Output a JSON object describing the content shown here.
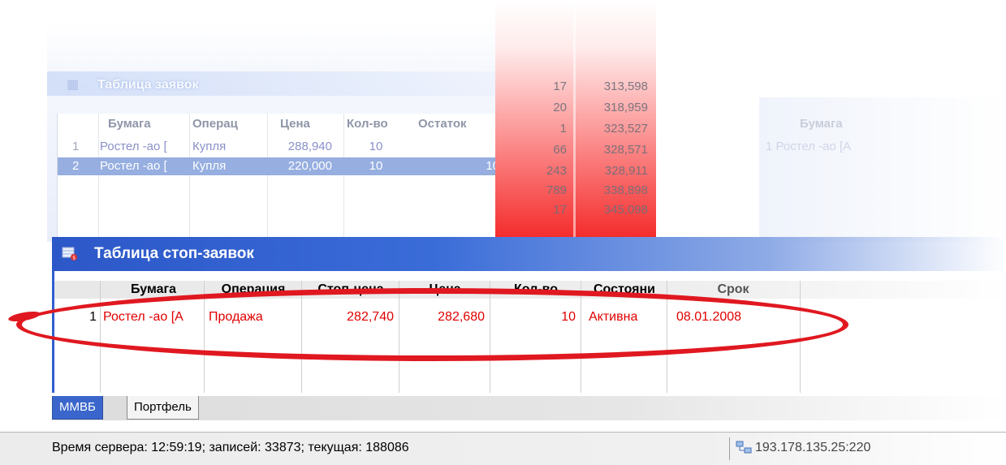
{
  "orders_window": {
    "title": "Таблица заявок",
    "columns": [
      "Бумага",
      "Операц",
      "Цена",
      "Кол-во",
      "Остаток"
    ],
    "rows": [
      {
        "num": "1",
        "paper": "Ростел -ао [",
        "operation": "Купля",
        "price": "288,940",
        "qty": "10",
        "rest": ""
      },
      {
        "num": "2",
        "paper": "Ростел -ао [",
        "operation": "Купля",
        "price": "220,000",
        "qty": "10",
        "rest": "10"
      }
    ]
  },
  "price_ladder": {
    "rows": [
      {
        "qty": "17",
        "price": "313,598"
      },
      {
        "qty": "20",
        "price": "318,959"
      },
      {
        "qty": "1",
        "price": "323,527"
      },
      {
        "qty": "66",
        "price": "328,571"
      },
      {
        "qty": "243",
        "price": "328,911"
      },
      {
        "qty": "789",
        "price": "338,898"
      },
      {
        "qty": "17",
        "price": "345,098"
      }
    ]
  },
  "right_panel": {
    "header": "Бумага",
    "row": "1  Ростел -ао [А"
  },
  "stop_window": {
    "title": "Таблица стоп-заявок",
    "columns": [
      "Бумага",
      "Операция",
      "Стоп-цена",
      "Цена",
      "Кол-во",
      "Состояни",
      "Срок"
    ],
    "row": {
      "num": "1",
      "paper": "Ростел -ао [А",
      "operation": "Продажа",
      "stop_price": "282,740",
      "price": "282,680",
      "qty": "10",
      "state": "Активна",
      "term": "08.01.2008"
    }
  },
  "tabs": [
    {
      "label": "ММВБ",
      "active": true
    },
    {
      "label": "Портфель",
      "active": false
    }
  ],
  "statusbar": {
    "text": "Время сервера: 12:59:19; записей: 33873; текущая: 188086",
    "server": "193.178.135.25:220"
  },
  "colors": {
    "titlebar": "#2c57c8",
    "highlight": "#e01820",
    "active_text": "#e00000",
    "selection": "#96aee0"
  }
}
